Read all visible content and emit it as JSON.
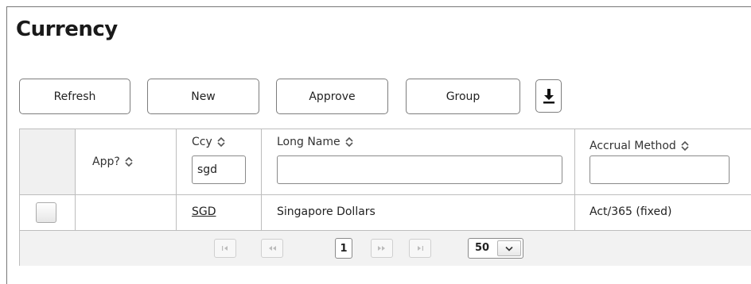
{
  "page": {
    "title": "Currency"
  },
  "toolbar": {
    "refresh_label": "Refresh",
    "new_label": "New",
    "approve_label": "Approve",
    "group_label": "Group",
    "download_icon": "download-icon"
  },
  "table": {
    "columns": [
      {
        "label": "",
        "sortable": false
      },
      {
        "label": "App?",
        "sortable": true
      },
      {
        "label": "Ccy",
        "sortable": true,
        "filter_value": "sgd"
      },
      {
        "label": "Long Name",
        "sortable": true,
        "filter_value": ""
      },
      {
        "label": "Accrual Method",
        "sortable": true,
        "filter_value": ""
      }
    ],
    "rows": [
      {
        "checked": false,
        "app": "",
        "ccy": "SGD",
        "long_name": "Singapore Dollars",
        "accrual_method": "Act/365 (fixed)"
      }
    ]
  },
  "pager": {
    "first_icon": "first-page-icon",
    "prev_icon": "prev-page-icon",
    "current_page": "1",
    "next_icon": "next-page-icon",
    "last_icon": "last-page-icon",
    "page_size": "50"
  },
  "colors": {
    "border": "#bdbdbd",
    "pager_bg": "#f2f2f2",
    "disabled_text": "#b9b9b9"
  }
}
